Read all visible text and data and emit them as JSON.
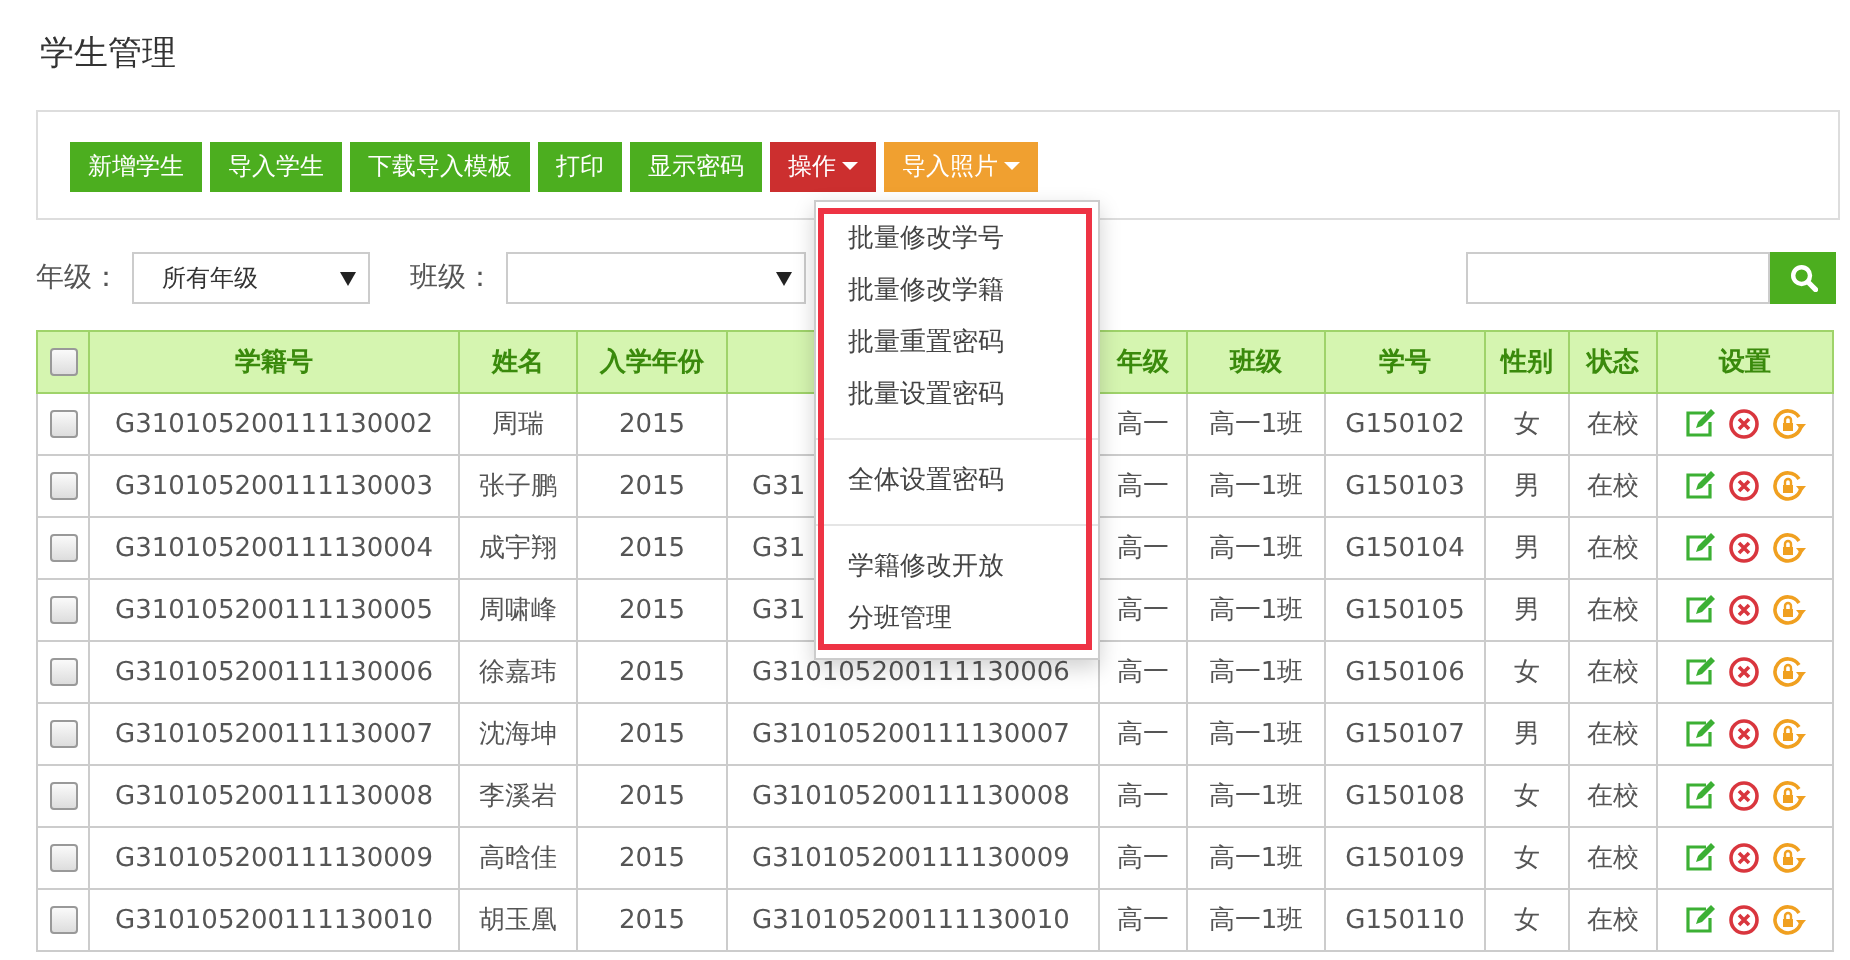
{
  "page_title": "学生管理",
  "toolbar": [
    {
      "label": "新增学生",
      "kind": "success",
      "dropdown": false,
      "expanded": false
    },
    {
      "label": "导入学生",
      "kind": "success",
      "dropdown": false,
      "expanded": false
    },
    {
      "label": "下载导入模板",
      "kind": "success",
      "dropdown": false,
      "expanded": false
    },
    {
      "label": "打印",
      "kind": "success",
      "dropdown": false,
      "expanded": false
    },
    {
      "label": "显示密码",
      "kind": "success",
      "dropdown": false,
      "expanded": false
    },
    {
      "label": "操作",
      "kind": "danger",
      "dropdown": true,
      "expanded": true
    },
    {
      "label": "导入照片",
      "kind": "warning",
      "dropdown": true,
      "expanded": false
    }
  ],
  "menu": {
    "groups": [
      [
        "批量修改学号",
        "批量修改学籍",
        "批量重置密码",
        "批量设置密码"
      ],
      [
        "全体设置密码"
      ],
      [
        "学籍修改开放",
        "分班管理"
      ]
    ],
    "highlighted": true
  },
  "filters": {
    "grade_label": "年级：",
    "grade_value": "所有年级",
    "class_label": "班级："
  },
  "table": {
    "select_all_checked": false,
    "columns": {
      "student_id": "学籍号",
      "name": "姓名",
      "year": "入学年份",
      "grade": "年级",
      "class": "班级",
      "number": "学号",
      "gender": "性别",
      "status": "状态",
      "actions": "设置"
    },
    "rows": [
      {
        "checked": false,
        "student_id": "G310105200111130002",
        "name": "周瑞",
        "year": "2015",
        "grade": "高一",
        "class": "高一1班",
        "number": "G150102",
        "gender": "女",
        "status": "在校"
      },
      {
        "checked": false,
        "student_id": "G310105200111130003",
        "name": "张子鹏",
        "year": "2015",
        "column_5": "G31",
        "grade": "高一",
        "class": "高一1班",
        "number": "G150103",
        "gender": "男",
        "status": "在校"
      },
      {
        "checked": false,
        "student_id": "G310105200111130004",
        "name": "成宇翔",
        "year": "2015",
        "column_5": "G31",
        "grade": "高一",
        "class": "高一1班",
        "number": "G150104",
        "gender": "男",
        "status": "在校"
      },
      {
        "checked": false,
        "student_id": "G310105200111130005",
        "name": "周啸峰",
        "year": "2015",
        "column_5": "G31",
        "grade": "高一",
        "class": "高一1班",
        "number": "G150105",
        "gender": "男",
        "status": "在校"
      },
      {
        "checked": false,
        "student_id": "G310105200111130006",
        "name": "徐嘉玮",
        "year": "2015",
        "column_5": "G310105200111130006",
        "grade": "高一",
        "class": "高一1班",
        "number": "G150106",
        "gender": "女",
        "status": "在校"
      },
      {
        "checked": false,
        "student_id": "G310105200111130007",
        "name": "沈海坤",
        "year": "2015",
        "column_5": "G310105200111130007",
        "grade": "高一",
        "class": "高一1班",
        "number": "G150107",
        "gender": "男",
        "status": "在校"
      },
      {
        "checked": false,
        "student_id": "G310105200111130008",
        "name": "李溪岩",
        "year": "2015",
        "column_5": "G310105200111130008",
        "grade": "高一",
        "class": "高一1班",
        "number": "G150108",
        "gender": "女",
        "status": "在校"
      },
      {
        "checked": false,
        "student_id": "G310105200111130009",
        "name": "高晗佳",
        "year": "2015",
        "column_5": "G310105200111130009",
        "grade": "高一",
        "class": "高一1班",
        "number": "G150109",
        "gender": "女",
        "status": "在校"
      },
      {
        "checked": false,
        "student_id": "G310105200111130010",
        "name": "胡玉凰",
        "year": "2015",
        "column_5": "G310105200111130010",
        "grade": "高一",
        "class": "高一1班",
        "number": "G150110",
        "gender": "女",
        "status": "在校"
      }
    ]
  }
}
